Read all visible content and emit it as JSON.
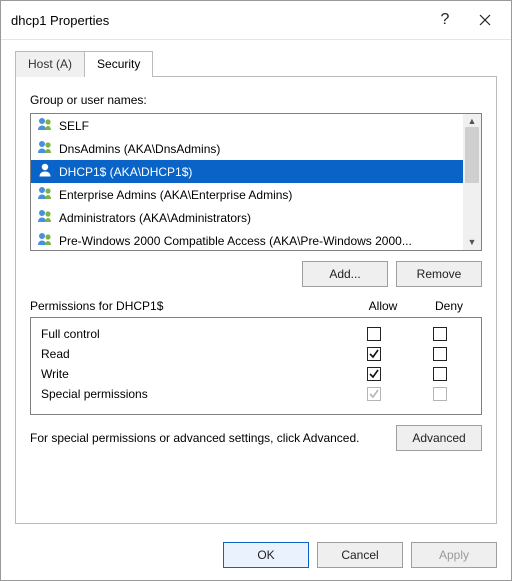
{
  "window": {
    "title": "dhcp1 Properties",
    "help_glyph": "?"
  },
  "tabs": [
    {
      "label": "Host (A)",
      "active": false
    },
    {
      "label": "Security",
      "active": true
    }
  ],
  "group_label": "Group or user names:",
  "principals": [
    {
      "name": "SELF",
      "kind": "group",
      "selected": false
    },
    {
      "name": "DnsAdmins (AKA\\DnsAdmins)",
      "kind": "group",
      "selected": false
    },
    {
      "name": "DHCP1$ (AKA\\DHCP1$)",
      "kind": "user",
      "selected": true
    },
    {
      "name": "Enterprise Admins (AKA\\Enterprise Admins)",
      "kind": "group",
      "selected": false
    },
    {
      "name": "Administrators (AKA\\Administrators)",
      "kind": "group",
      "selected": false
    },
    {
      "name": "Pre-Windows 2000 Compatible Access (AKA\\Pre-Windows 2000...",
      "kind": "group",
      "selected": false
    }
  ],
  "buttons": {
    "add": "Add...",
    "remove": "Remove",
    "advanced": "Advanced",
    "ok": "OK",
    "cancel": "Cancel",
    "apply": "Apply"
  },
  "perm_header": {
    "label": "Permissions for DHCP1$",
    "allow": "Allow",
    "deny": "Deny"
  },
  "permissions": [
    {
      "name": "Full control",
      "allow": "unchecked",
      "deny": "unchecked"
    },
    {
      "name": "Read",
      "allow": "checked",
      "deny": "unchecked"
    },
    {
      "name": "Write",
      "allow": "checked",
      "deny": "unchecked"
    },
    {
      "name": "Special permissions",
      "allow": "checked-disabled",
      "deny": "unchecked-disabled"
    }
  ],
  "advanced_text": "For special permissions or advanced settings, click Advanced."
}
